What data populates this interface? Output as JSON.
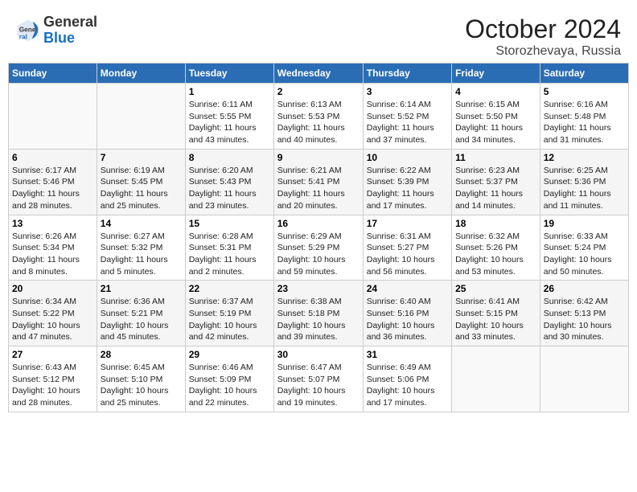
{
  "logo": {
    "general": "General",
    "blue": "Blue"
  },
  "title": "October 2024",
  "subtitle": "Storozhevaya, Russia",
  "weekdays": [
    "Sunday",
    "Monday",
    "Tuesday",
    "Wednesday",
    "Thursday",
    "Friday",
    "Saturday"
  ],
  "weeks": [
    [
      {
        "day": "",
        "content": ""
      },
      {
        "day": "",
        "content": ""
      },
      {
        "day": "1",
        "content": "Sunrise: 6:11 AM\nSunset: 5:55 PM\nDaylight: 11 hours\nand 43 minutes."
      },
      {
        "day": "2",
        "content": "Sunrise: 6:13 AM\nSunset: 5:53 PM\nDaylight: 11 hours\nand 40 minutes."
      },
      {
        "day": "3",
        "content": "Sunrise: 6:14 AM\nSunset: 5:52 PM\nDaylight: 11 hours\nand 37 minutes."
      },
      {
        "day": "4",
        "content": "Sunrise: 6:15 AM\nSunset: 5:50 PM\nDaylight: 11 hours\nand 34 minutes."
      },
      {
        "day": "5",
        "content": "Sunrise: 6:16 AM\nSunset: 5:48 PM\nDaylight: 11 hours\nand 31 minutes."
      }
    ],
    [
      {
        "day": "6",
        "content": "Sunrise: 6:17 AM\nSunset: 5:46 PM\nDaylight: 11 hours\nand 28 minutes."
      },
      {
        "day": "7",
        "content": "Sunrise: 6:19 AM\nSunset: 5:45 PM\nDaylight: 11 hours\nand 25 minutes."
      },
      {
        "day": "8",
        "content": "Sunrise: 6:20 AM\nSunset: 5:43 PM\nDaylight: 11 hours\nand 23 minutes."
      },
      {
        "day": "9",
        "content": "Sunrise: 6:21 AM\nSunset: 5:41 PM\nDaylight: 11 hours\nand 20 minutes."
      },
      {
        "day": "10",
        "content": "Sunrise: 6:22 AM\nSunset: 5:39 PM\nDaylight: 11 hours\nand 17 minutes."
      },
      {
        "day": "11",
        "content": "Sunrise: 6:23 AM\nSunset: 5:37 PM\nDaylight: 11 hours\nand 14 minutes."
      },
      {
        "day": "12",
        "content": "Sunrise: 6:25 AM\nSunset: 5:36 PM\nDaylight: 11 hours\nand 11 minutes."
      }
    ],
    [
      {
        "day": "13",
        "content": "Sunrise: 6:26 AM\nSunset: 5:34 PM\nDaylight: 11 hours\nand 8 minutes."
      },
      {
        "day": "14",
        "content": "Sunrise: 6:27 AM\nSunset: 5:32 PM\nDaylight: 11 hours\nand 5 minutes."
      },
      {
        "day": "15",
        "content": "Sunrise: 6:28 AM\nSunset: 5:31 PM\nDaylight: 11 hours\nand 2 minutes."
      },
      {
        "day": "16",
        "content": "Sunrise: 6:29 AM\nSunset: 5:29 PM\nDaylight: 10 hours\nand 59 minutes."
      },
      {
        "day": "17",
        "content": "Sunrise: 6:31 AM\nSunset: 5:27 PM\nDaylight: 10 hours\nand 56 minutes."
      },
      {
        "day": "18",
        "content": "Sunrise: 6:32 AM\nSunset: 5:26 PM\nDaylight: 10 hours\nand 53 minutes."
      },
      {
        "day": "19",
        "content": "Sunrise: 6:33 AM\nSunset: 5:24 PM\nDaylight: 10 hours\nand 50 minutes."
      }
    ],
    [
      {
        "day": "20",
        "content": "Sunrise: 6:34 AM\nSunset: 5:22 PM\nDaylight: 10 hours\nand 47 minutes."
      },
      {
        "day": "21",
        "content": "Sunrise: 6:36 AM\nSunset: 5:21 PM\nDaylight: 10 hours\nand 45 minutes."
      },
      {
        "day": "22",
        "content": "Sunrise: 6:37 AM\nSunset: 5:19 PM\nDaylight: 10 hours\nand 42 minutes."
      },
      {
        "day": "23",
        "content": "Sunrise: 6:38 AM\nSunset: 5:18 PM\nDaylight: 10 hours\nand 39 minutes."
      },
      {
        "day": "24",
        "content": "Sunrise: 6:40 AM\nSunset: 5:16 PM\nDaylight: 10 hours\nand 36 minutes."
      },
      {
        "day": "25",
        "content": "Sunrise: 6:41 AM\nSunset: 5:15 PM\nDaylight: 10 hours\nand 33 minutes."
      },
      {
        "day": "26",
        "content": "Sunrise: 6:42 AM\nSunset: 5:13 PM\nDaylight: 10 hours\nand 30 minutes."
      }
    ],
    [
      {
        "day": "27",
        "content": "Sunrise: 6:43 AM\nSunset: 5:12 PM\nDaylight: 10 hours\nand 28 minutes."
      },
      {
        "day": "28",
        "content": "Sunrise: 6:45 AM\nSunset: 5:10 PM\nDaylight: 10 hours\nand 25 minutes."
      },
      {
        "day": "29",
        "content": "Sunrise: 6:46 AM\nSunset: 5:09 PM\nDaylight: 10 hours\nand 22 minutes."
      },
      {
        "day": "30",
        "content": "Sunrise: 6:47 AM\nSunset: 5:07 PM\nDaylight: 10 hours\nand 19 minutes."
      },
      {
        "day": "31",
        "content": "Sunrise: 6:49 AM\nSunset: 5:06 PM\nDaylight: 10 hours\nand 17 minutes."
      },
      {
        "day": "",
        "content": ""
      },
      {
        "day": "",
        "content": ""
      }
    ]
  ]
}
